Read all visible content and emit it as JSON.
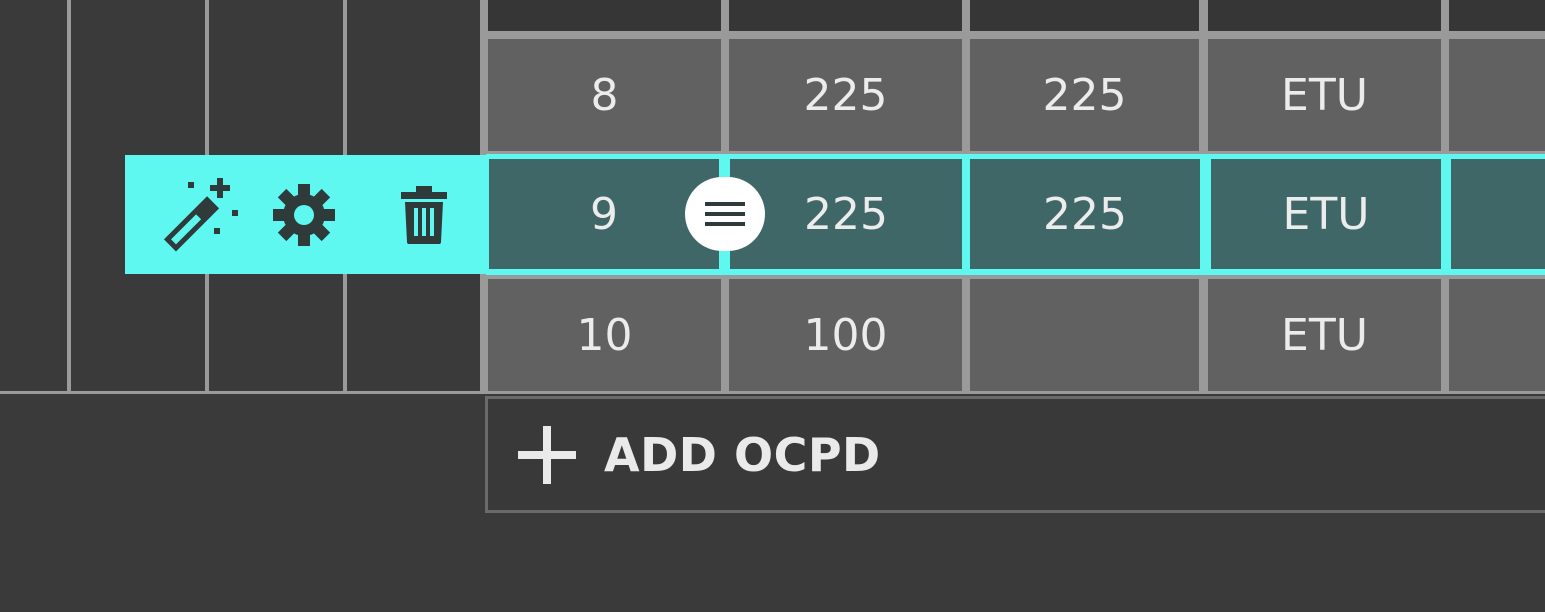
{
  "table": {
    "rows": [
      {
        "number": "8",
        "col2": "225",
        "col3": "225",
        "col4": "ETU",
        "selected": false
      },
      {
        "number": "9",
        "col2": "225",
        "col3": "225",
        "col4": "ETU",
        "selected": true
      },
      {
        "number": "10",
        "col2": "100",
        "col3": "",
        "col4": "ETU",
        "selected": false
      }
    ]
  },
  "row_actions": {
    "icons": [
      "magic-wand-icon",
      "gear-icon",
      "trash-icon"
    ]
  },
  "drag_handle": {
    "icon": "menu-icon"
  },
  "add_button": {
    "label": "ADD OCPD",
    "icon": "plus-icon"
  },
  "colors": {
    "background": "#3a3a3a",
    "cell": "#616161",
    "selected_cell": "#3f6767",
    "accent": "#5ef8f0",
    "grid_line": "#9a9a9a",
    "text": "#ececec"
  }
}
